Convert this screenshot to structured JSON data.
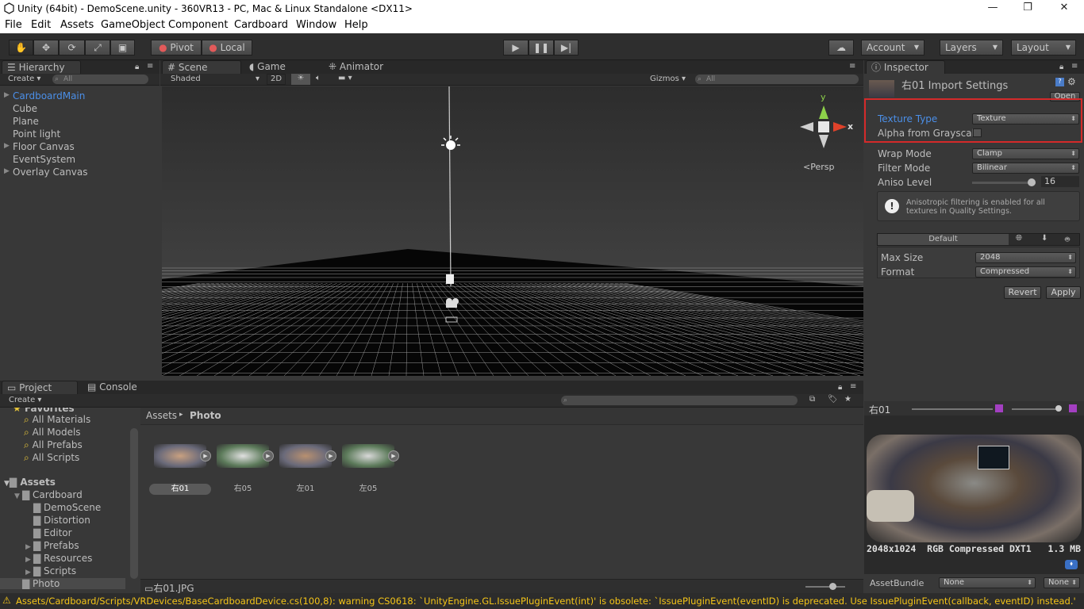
{
  "window": {
    "title": "Unity (64bit) - DemoScene.unity - 360VR13 - PC, Mac & Linux Standalone <DX11>",
    "minimize": "—",
    "restore": "❐",
    "close": "✕"
  },
  "menu": [
    "File",
    "Edit",
    "Assets",
    "GameObject",
    "Component",
    "Cardboard",
    "Window",
    "Help"
  ],
  "toolbar": {
    "pivot": "Pivot",
    "local": "Local",
    "account": "Account",
    "layers": "Layers",
    "layout": "Layout"
  },
  "hierarchy": {
    "tab": "Hierarchy",
    "create": "Create",
    "search_placeholder": "All",
    "items": [
      "CardboardMain",
      "Cube",
      "Plane",
      "Point light",
      "Floor Canvas",
      "EventSystem",
      "Overlay Canvas"
    ]
  },
  "scene": {
    "tabs": [
      "Scene",
      "Game",
      "Animator"
    ],
    "shading": "Shaded",
    "mode2d": "2D",
    "gizmos": "Gizmos",
    "search_placeholder": "All",
    "persp": "Persp",
    "axis_x": "x",
    "axis_y": "y"
  },
  "inspector": {
    "tab": "Inspector",
    "title": "右01 Import Settings",
    "open": "Open",
    "texture_type_label": "Texture Type",
    "texture_type_value": "Texture",
    "alpha_label": "Alpha from Grayscal",
    "wrap_label": "Wrap Mode",
    "wrap_value": "Clamp",
    "filter_label": "Filter Mode",
    "filter_value": "Bilinear",
    "aniso_label": "Aniso Level",
    "aniso_value": "16",
    "aniso_fraction": 1.0,
    "info": "Anisotropic filtering is enabled for all textures in Quality Settings.",
    "platform_default": "Default",
    "max_size_label": "Max Size",
    "max_size_value": "2048",
    "format_label": "Format",
    "format_value": "Compressed",
    "revert": "Revert",
    "apply": "Apply",
    "highlight_color": "#d42a2a"
  },
  "preview": {
    "name": "右01",
    "info": "2048x1024  RGB Compressed DXT1   1.3 MB",
    "assetbundle_label": "AssetBundle",
    "assetbundle_value": "None",
    "variant_value": "None"
  },
  "project": {
    "tabs": [
      "Project",
      "Console"
    ],
    "create": "Create",
    "favorites_label": "Favorites",
    "favorites": [
      "All Materials",
      "All Models",
      "All Prefabs",
      "All Scripts"
    ],
    "assets_label": "Assets",
    "folders": [
      {
        "name": "Cardboard",
        "depth": 1,
        "open": true
      },
      {
        "name": "DemoScene",
        "depth": 2
      },
      {
        "name": "Distortion",
        "depth": 2
      },
      {
        "name": "Editor",
        "depth": 2
      },
      {
        "name": "Prefabs",
        "depth": 2,
        "arrow": true
      },
      {
        "name": "Resources",
        "depth": 2,
        "arrow": true
      },
      {
        "name": "Scripts",
        "depth": 2,
        "arrow": true
      },
      {
        "name": "Photo",
        "depth": 1,
        "selected": true
      }
    ],
    "breadcrumb_root": "Assets",
    "breadcrumb_leaf": "Photo",
    "files": [
      "右01",
      "右05",
      "左01",
      "左05"
    ],
    "selected_file": "右01.JPG"
  },
  "status": {
    "warning": "Assets/Cardboard/Scripts/VRDevices/BaseCardboardDevice.cs(100,8): warning CS0618: `UnityEngine.GL.IssuePluginEvent(int)' is obsolete: `IssuePluginEvent(eventID) is deprecated. Use IssuePluginEvent(callback, eventID) instead.'"
  }
}
